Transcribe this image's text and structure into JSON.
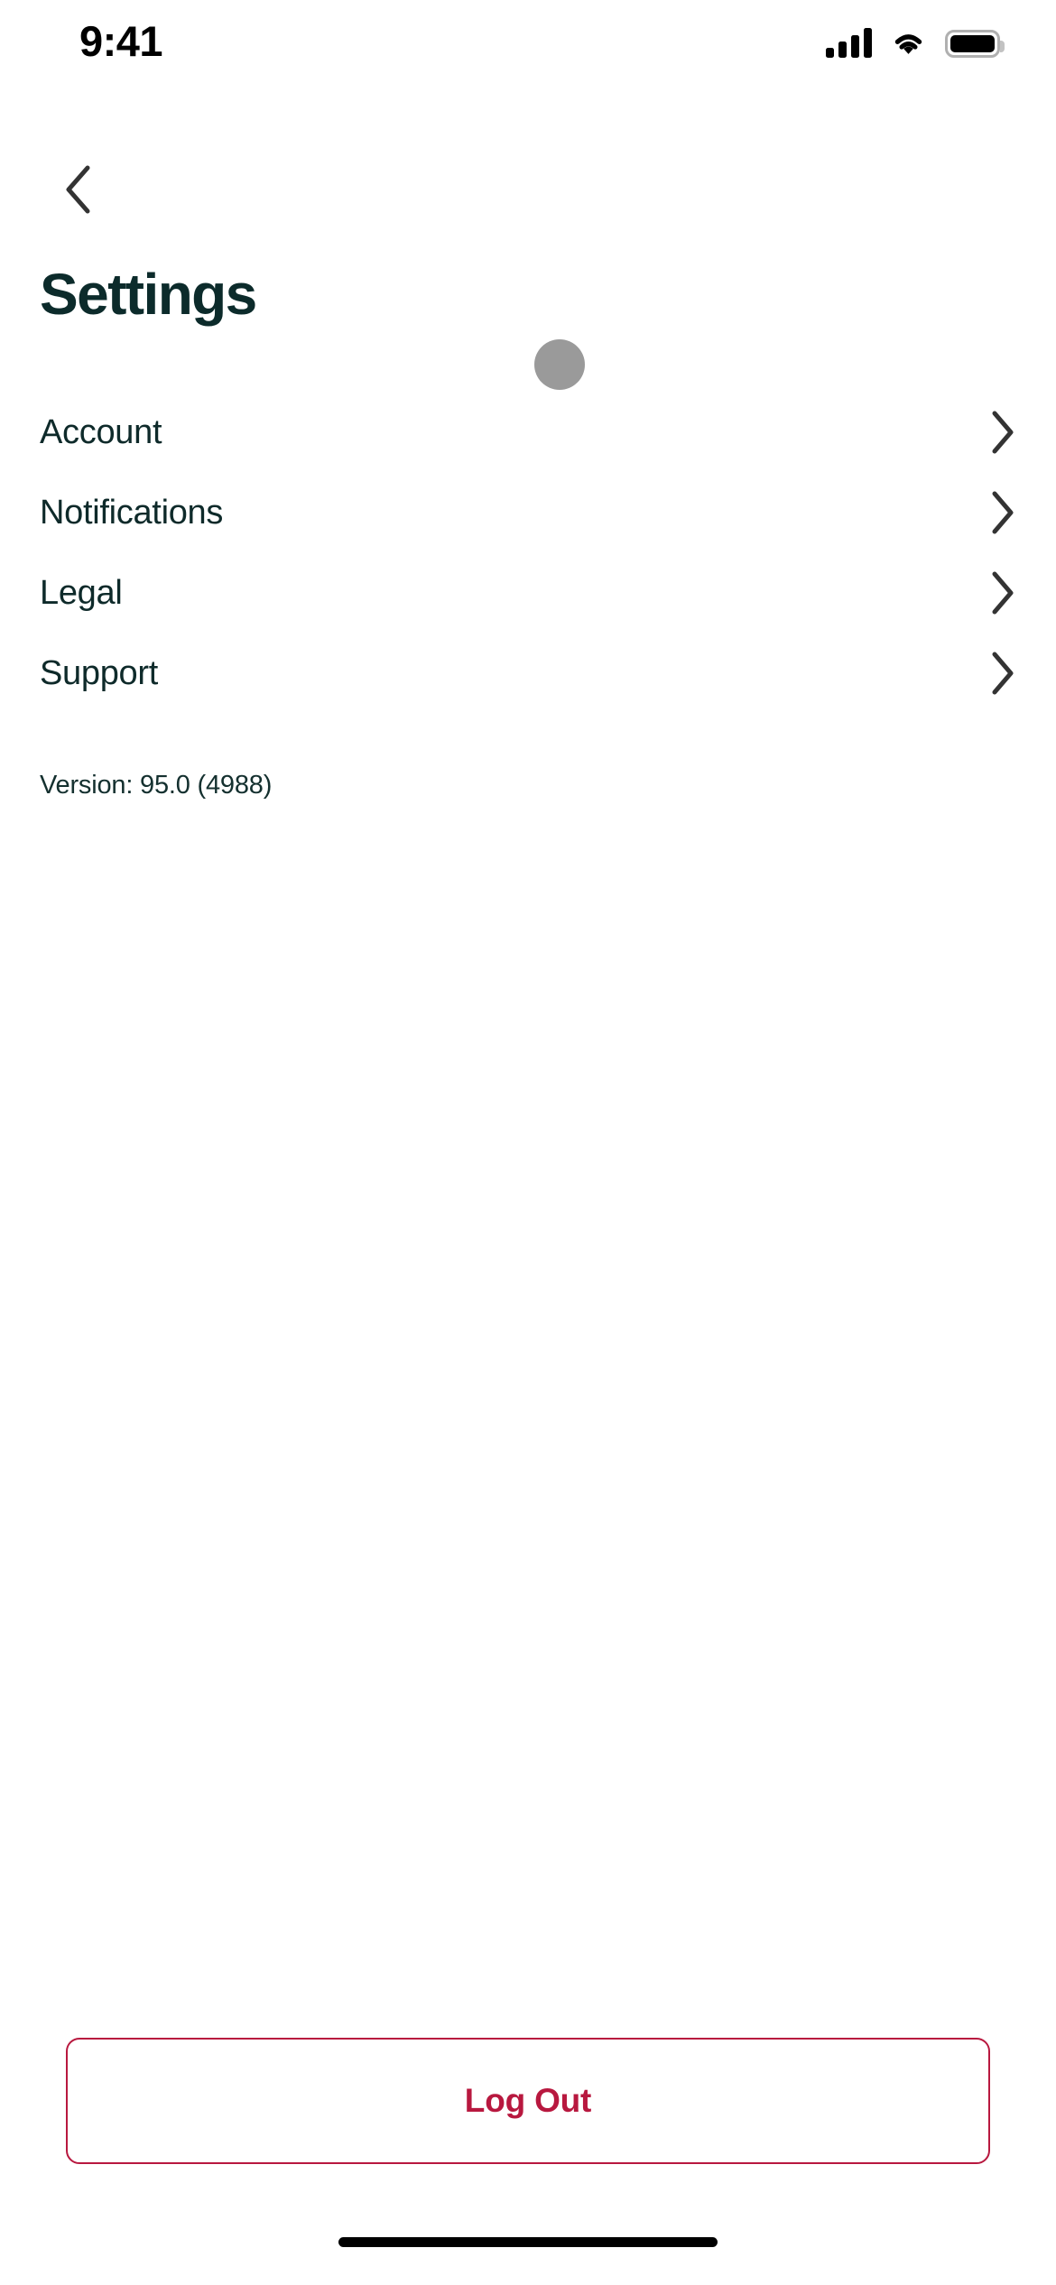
{
  "status_bar": {
    "time": "9:41",
    "signal_icon": "cellular-signal-icon",
    "wifi_icon": "wifi-icon",
    "battery_icon": "battery-full-icon",
    "signal_bars": 4,
    "battery_full": true
  },
  "nav": {
    "back_icon": "chevron-left-icon"
  },
  "header": {
    "title": "Settings",
    "decorative_dot_color": "#9a9a9a"
  },
  "settings_list": {
    "items": [
      {
        "label": "Account",
        "chevron_icon": "chevron-right-icon"
      },
      {
        "label": "Notifications",
        "chevron_icon": "chevron-right-icon"
      },
      {
        "label": "Legal",
        "chevron_icon": "chevron-right-icon"
      },
      {
        "label": "Support",
        "chevron_icon": "chevron-right-icon"
      }
    ]
  },
  "version": {
    "text": "Version: 95.0 (4988)"
  },
  "footer": {
    "logout_label": "Log Out",
    "logout_color": "#b8183f"
  },
  "colors": {
    "title": "#0c2b2b",
    "row_label": "#0e2a2a",
    "accent_danger": "#b8183f",
    "background": "#ffffff"
  }
}
